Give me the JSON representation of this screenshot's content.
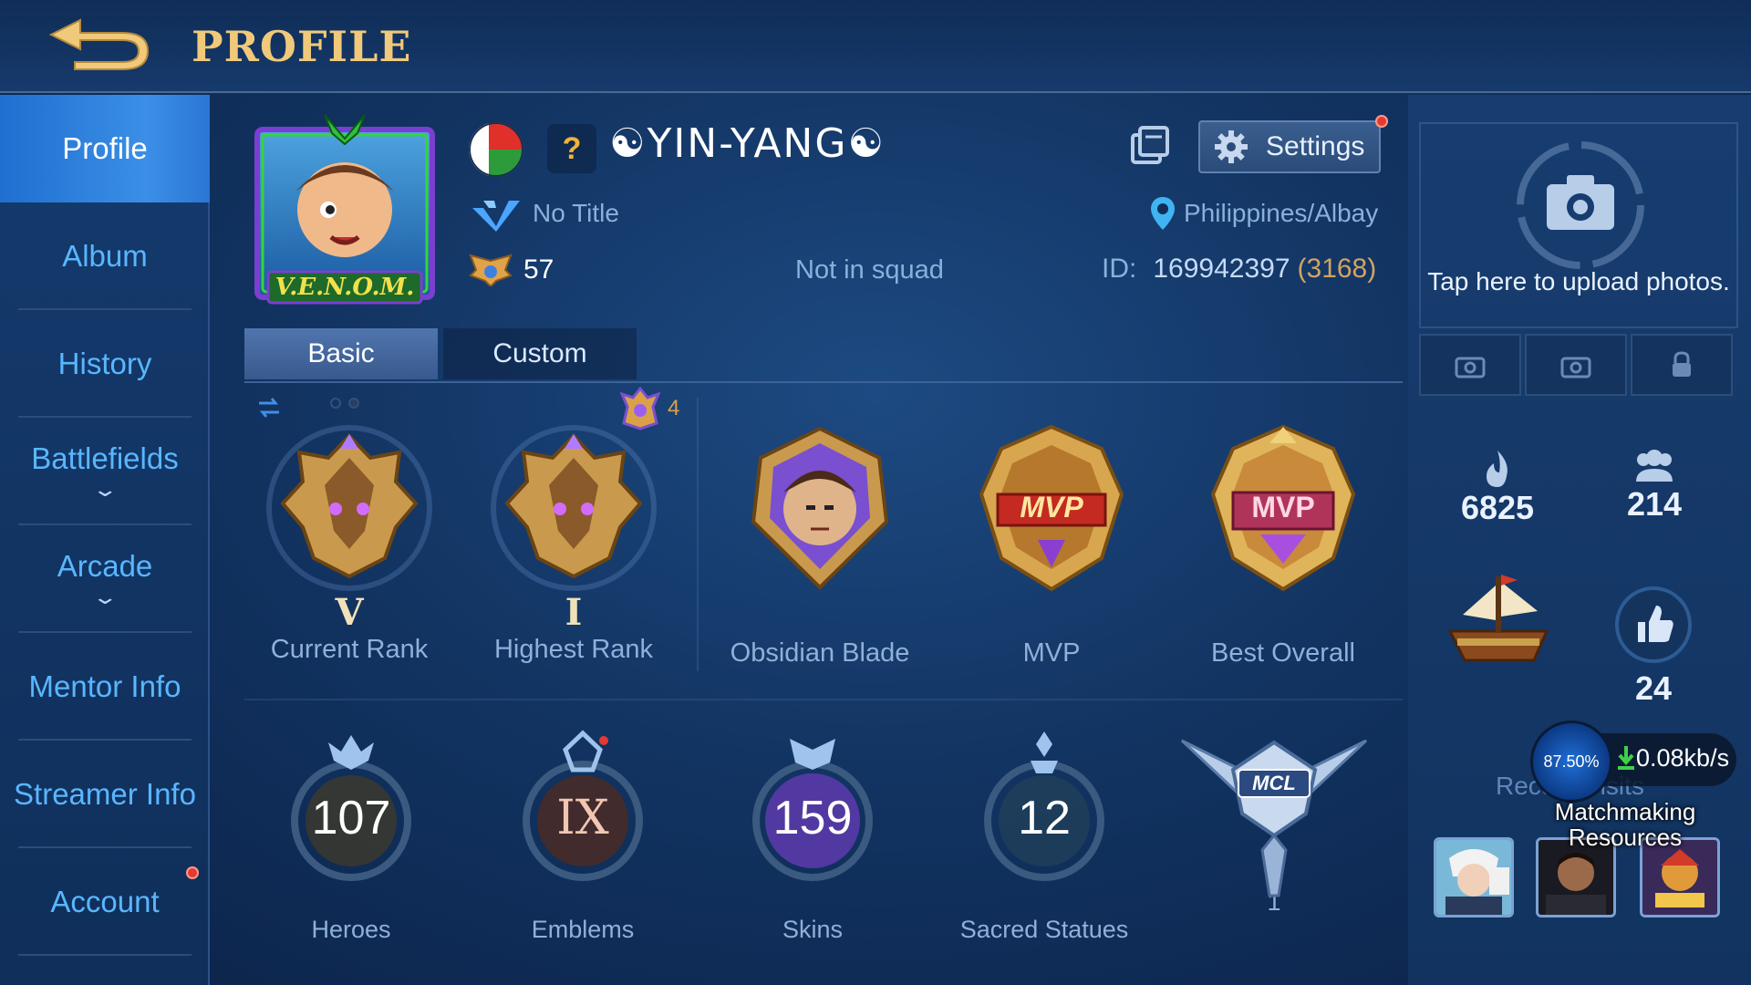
{
  "header": {
    "title": "PROFILE",
    "back_icon": "back-arrow-icon"
  },
  "sidebar": {
    "items": [
      {
        "label": "Profile",
        "active": true
      },
      {
        "label": "Album"
      },
      {
        "label": "History"
      },
      {
        "label": "Battlefields",
        "expandable": true
      },
      {
        "label": "Arcade",
        "expandable": true
      },
      {
        "label": "Mentor Info"
      },
      {
        "label": "Streamer Info"
      },
      {
        "label": "Account",
        "notification": true
      }
    ]
  },
  "player": {
    "avatar_text": "V.E.N.O.M.",
    "question_mark": "?",
    "name": "☯YIN-YANG☯",
    "title": "No Title",
    "level": "57",
    "squad": "Not in squad",
    "location": "Philippines/Albay",
    "id_label": "ID:",
    "id_number": "169942397",
    "server": "(3168)"
  },
  "settings": {
    "label": "Settings",
    "has_notification": true
  },
  "tabs": [
    {
      "label": "Basic",
      "active": true
    },
    {
      "label": "Custom"
    }
  ],
  "rank_stars": "4",
  "badges": [
    {
      "label": "Current Rank",
      "roman": "V",
      "icon": "mythic-rank-icon"
    },
    {
      "label": "Highest Rank",
      "roman": "I",
      "icon": "mythic-rank-icon"
    },
    {
      "label": "Obsidian Blade",
      "icon": "obsidian-blade-icon"
    },
    {
      "label": "MVP",
      "icon": "mvp-badge-icon",
      "emblem_text": "MVP"
    },
    {
      "label": "Best Overall",
      "icon": "best-overall-icon",
      "emblem_text": "MVP"
    }
  ],
  "stats": [
    {
      "label": "Heroes",
      "value": "107",
      "color": "#c8a95a"
    },
    {
      "label": "Emblems",
      "value": "IX",
      "color": "#c3523c"
    },
    {
      "label": "Skins",
      "value": "159",
      "color": "#7a4fd0"
    },
    {
      "label": "Sacred Statues",
      "value": "12",
      "color": "#3ea07a"
    },
    {
      "label": "1",
      "value": "MCL",
      "color": "#9bb8e0"
    }
  ],
  "right_panel": {
    "upload_text": "Tap here to upload photos.",
    "popularity": "6825",
    "followers": "214",
    "likes": "24",
    "recent_visits": "Recent Visits",
    "network": {
      "percent": "87.50%",
      "speed": "0.08kb/s"
    },
    "matchmaking": "Matchmaking Resources"
  },
  "colors": {
    "accent_gold": "#f0c97a",
    "link_blue": "#59b6ff",
    "active_tab": "#3b8fe6",
    "notification_red": "#e53a30"
  }
}
